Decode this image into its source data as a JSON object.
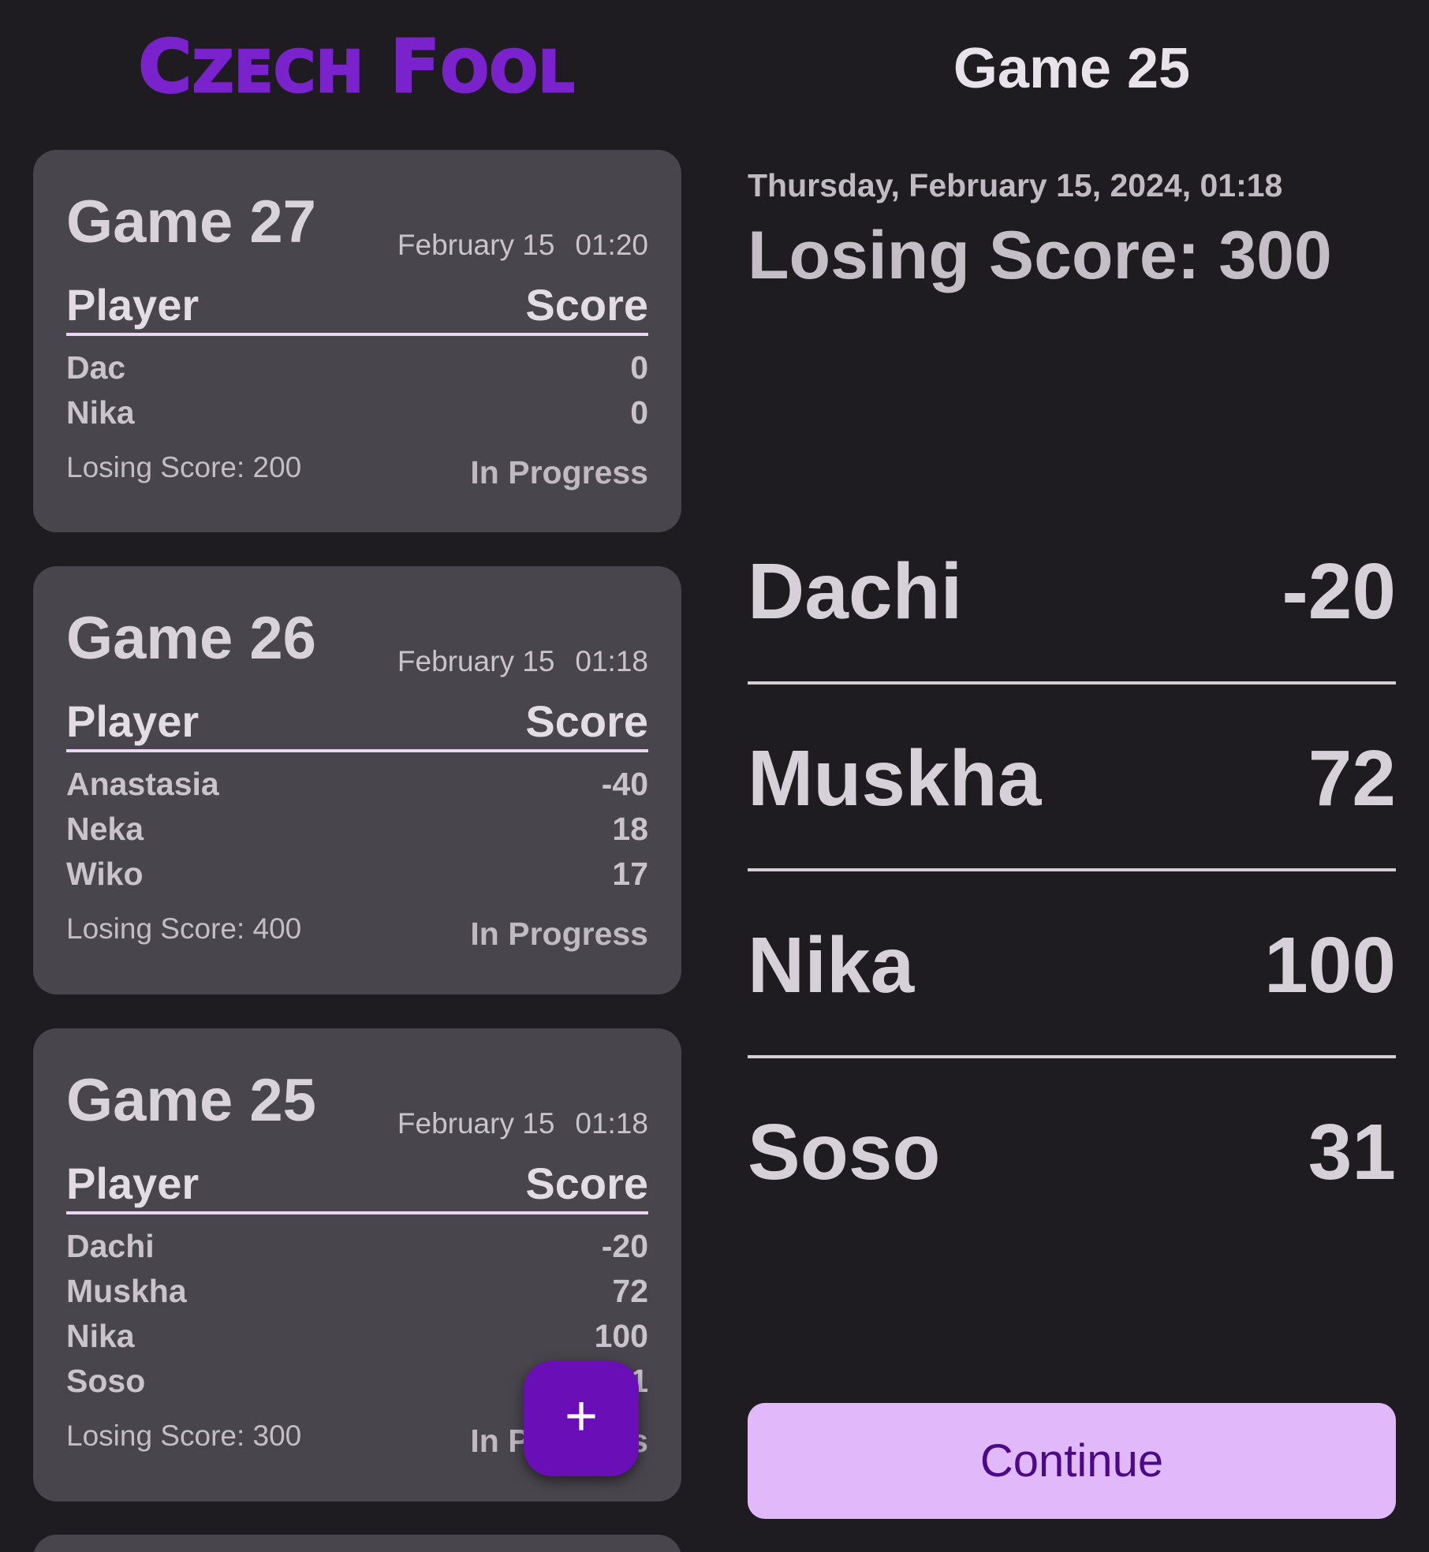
{
  "app": {
    "title": "Czech Fool"
  },
  "detail": {
    "header": "Game 25",
    "datetime": "Thursday, February 15, 2024, 01:18",
    "losing_score": "Losing Score: 300",
    "players": [
      {
        "name": "Dachi",
        "score": "-20"
      },
      {
        "name": "Muskha",
        "score": "72"
      },
      {
        "name": "Nika",
        "score": "100"
      },
      {
        "name": "Soso",
        "score": "31"
      }
    ],
    "continue_label": "Continue"
  },
  "cards": [
    {
      "title": "Game 27",
      "date": "February 15",
      "time": "01:20",
      "col_player": "Player",
      "col_score": "Score",
      "players": [
        {
          "name": "Dac",
          "score": "0"
        },
        {
          "name": "Nika",
          "score": "0"
        }
      ],
      "losing_score": "Losing Score: 200",
      "status": "In Progress"
    },
    {
      "title": "Game 26",
      "date": "February 15",
      "time": "01:18",
      "col_player": "Player",
      "col_score": "Score",
      "players": [
        {
          "name": "Anastasia",
          "score": "-40"
        },
        {
          "name": "Neka",
          "score": "18"
        },
        {
          "name": "Wiko",
          "score": "17"
        }
      ],
      "losing_score": "Losing Score: 400",
      "status": "In Progress"
    },
    {
      "title": "Game 25",
      "date": "February 15",
      "time": "01:18",
      "col_player": "Player",
      "col_score": "Score",
      "players": [
        {
          "name": "Dachi",
          "score": "-20"
        },
        {
          "name": "Muskha",
          "score": "72"
        },
        {
          "name": "Nika",
          "score": "100"
        },
        {
          "name": "Soso",
          "score": "31"
        }
      ],
      "losing_score": "Losing Score: 300",
      "status": "In Progress"
    }
  ],
  "fab": {
    "icon": "plus-icon",
    "glyph": "+"
  },
  "colors": {
    "brand": "#7a22cc",
    "card_bg": "#48454c",
    "fab_bg": "#6a0fb8",
    "continue_bg": "#e1b9fb",
    "continue_text": "#4a0a86"
  }
}
